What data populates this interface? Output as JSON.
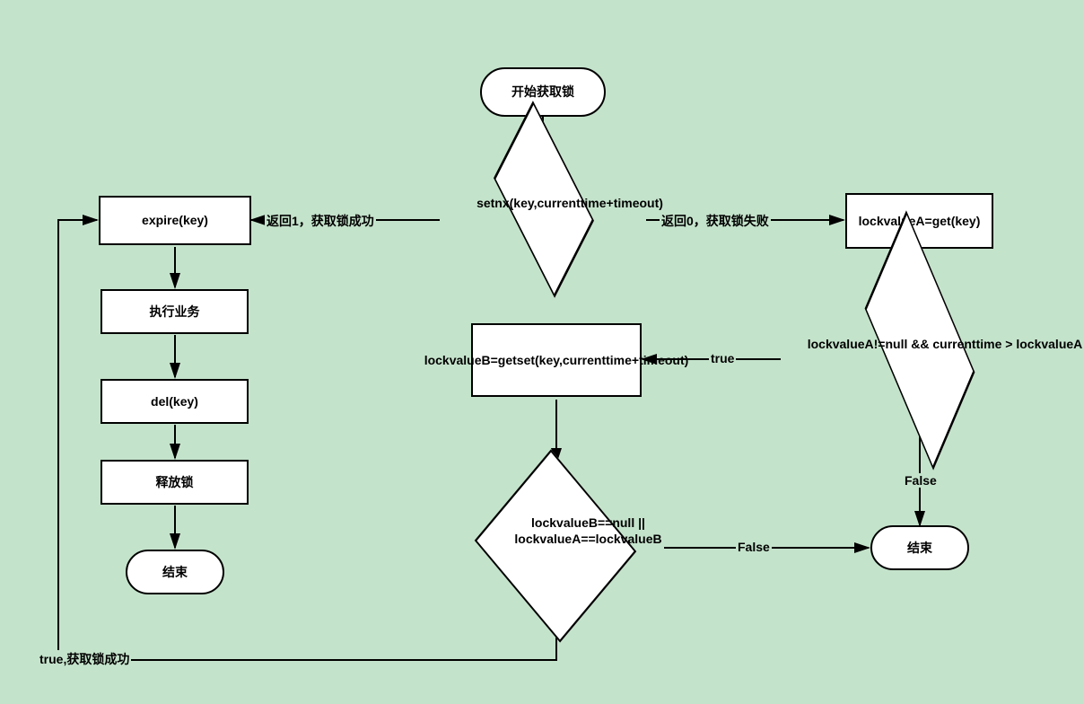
{
  "nodes": {
    "start": "开始获取锁",
    "setnx": "setnx(key,currenttime+timeout)",
    "expire": "expire(key)",
    "biz": "执行业务",
    "del": "del(key)",
    "release": "释放锁",
    "end1": "结束",
    "getA": "lockvalueA=get(key)",
    "checkA": "lockvalueA!=null  && currenttime > lockvalueA",
    "getset": "lockvalueB=getset(key,currenttime+timeout)",
    "checkB": "lockvalueB==null || lockvalueA==lockvalueB",
    "end2": "结束"
  },
  "edges": {
    "setnx_left": "返回1，获取锁成功",
    "setnx_right": "返回0，获取锁失败",
    "checkA_true": "true",
    "checkA_false": "False",
    "checkB_false": "False",
    "checkB_true": "true,获取锁成功"
  }
}
